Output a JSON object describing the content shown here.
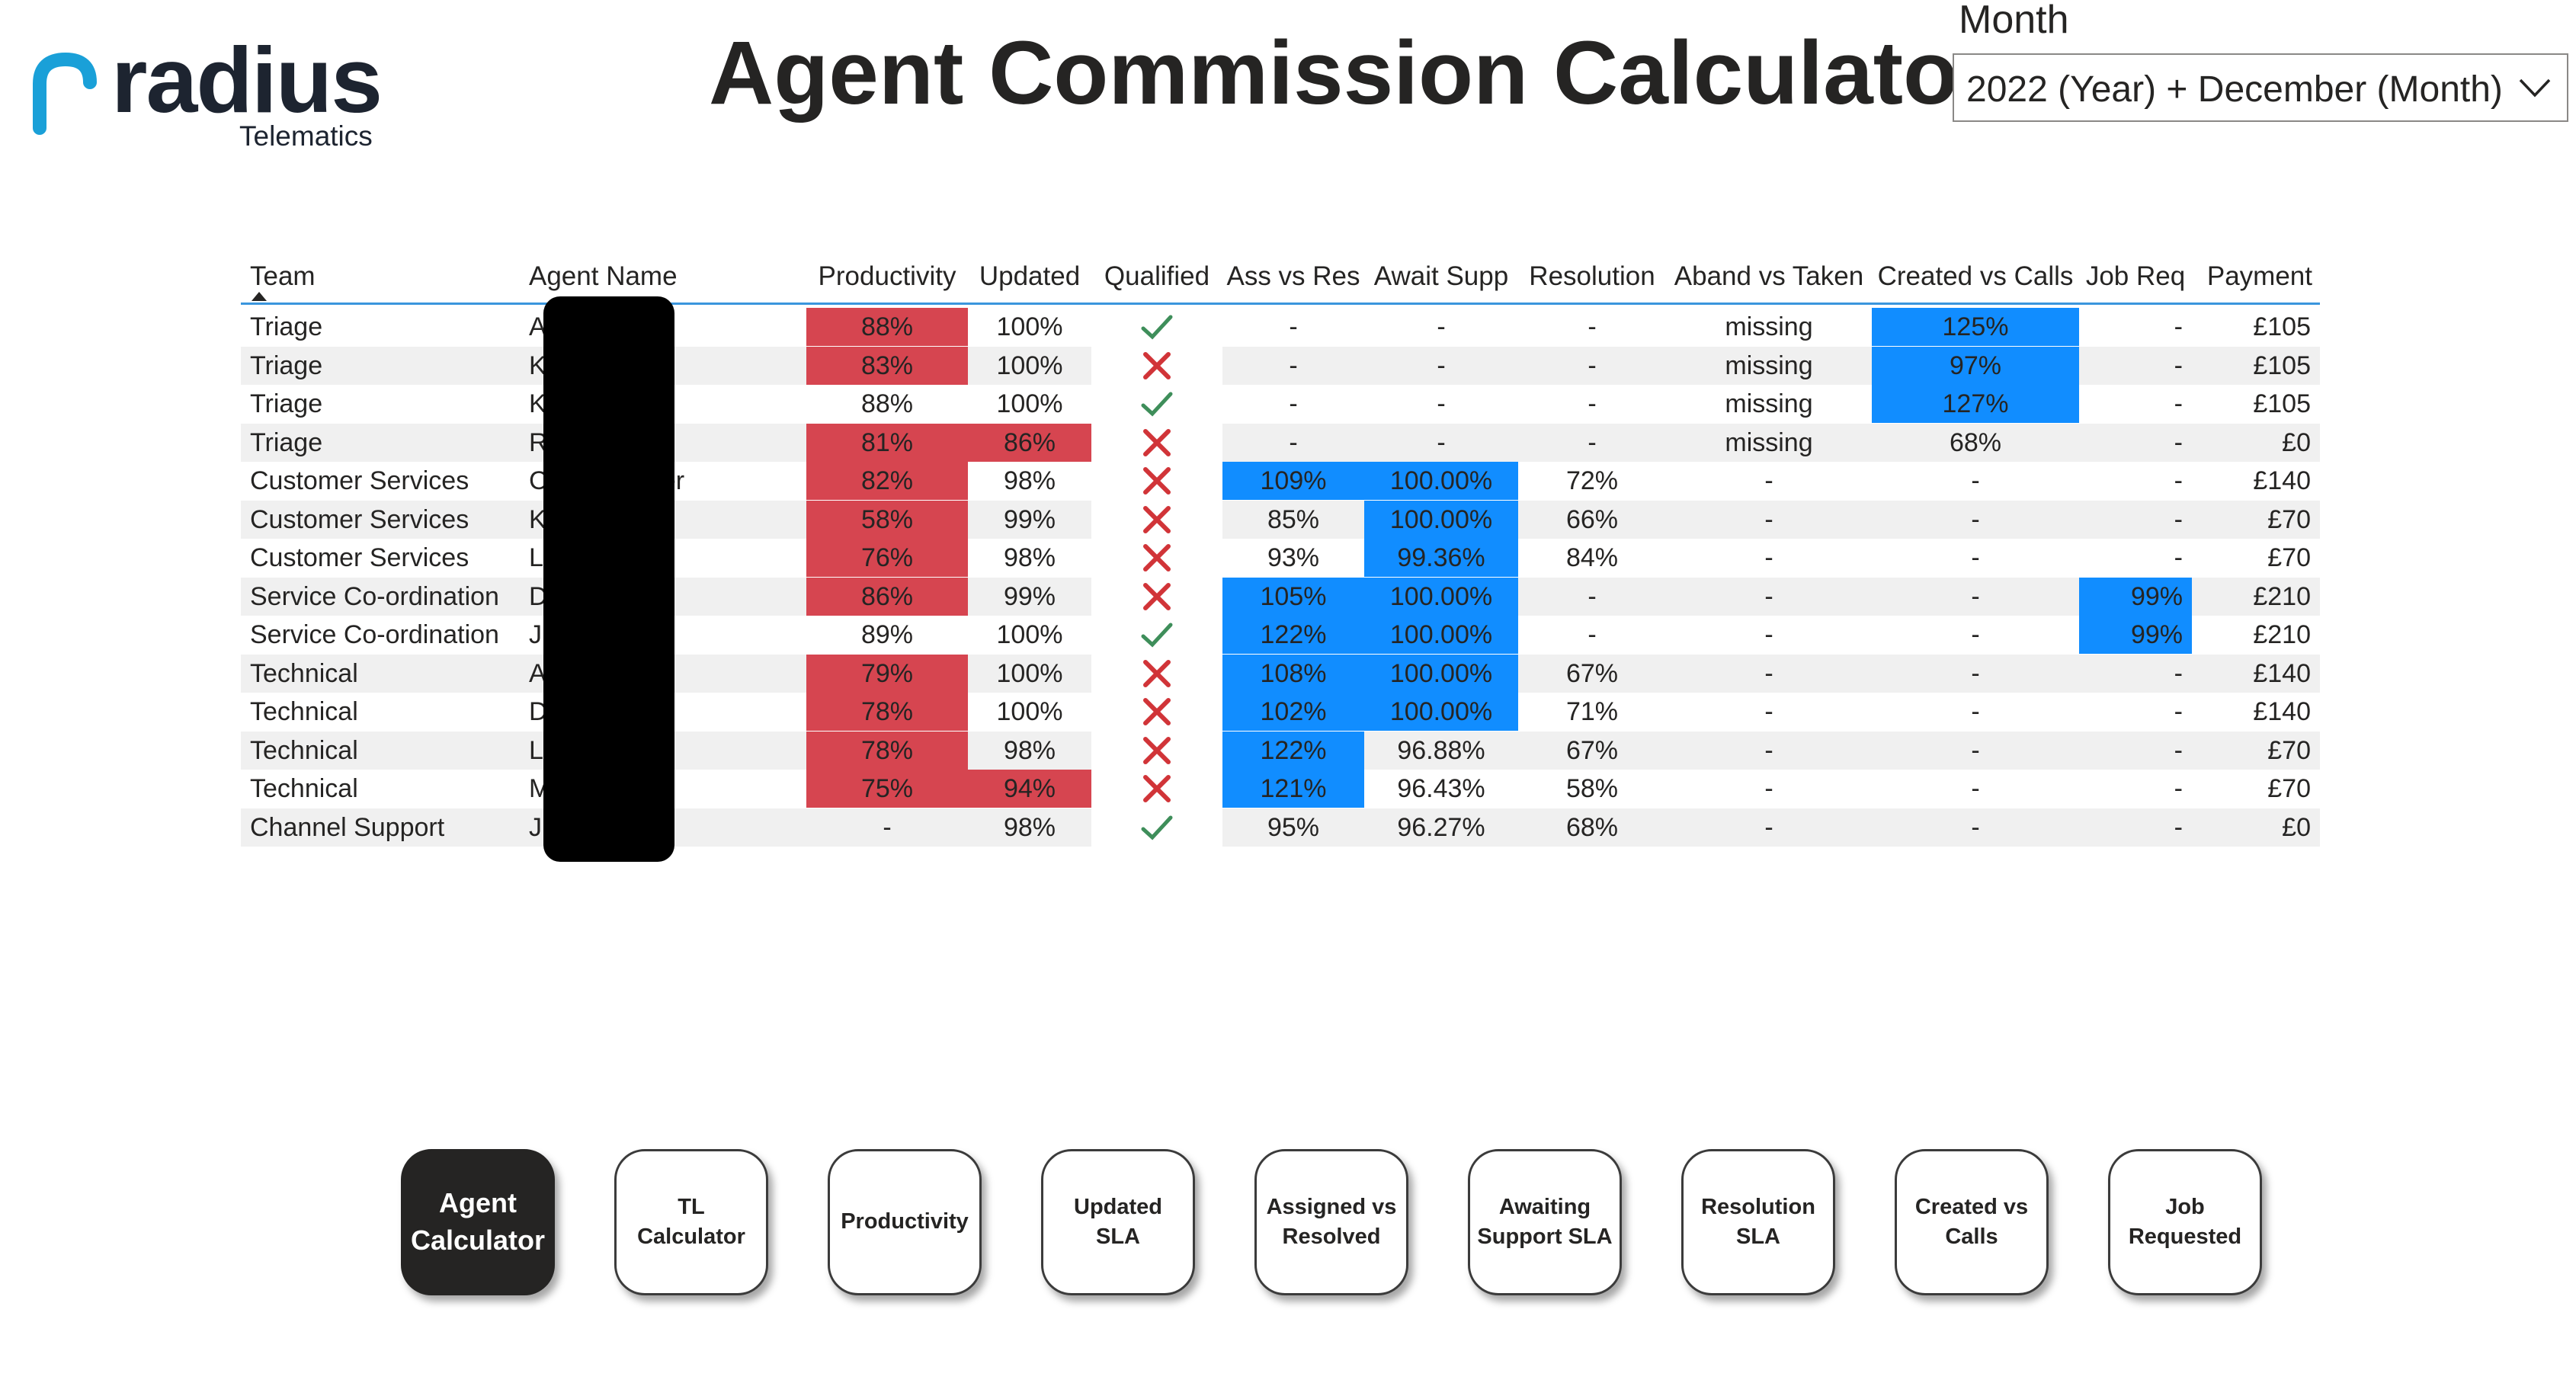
{
  "brand": {
    "name": "radius",
    "subtitle": "Telematics"
  },
  "page": {
    "title": "Agent Commission Calculator"
  },
  "month_filter": {
    "label": "Month",
    "value": "2022 (Year) + December (Month)"
  },
  "table": {
    "headers": {
      "team": "Team",
      "agent": "Agent Name",
      "productivity": "Productivity",
      "updated": "Updated",
      "qualified": "Qualified",
      "ass_vs_res": "Ass vs Res",
      "await_supp": "Await Supp",
      "resolution": "Resolution",
      "aband_vs_taken": "Aband vs Taken",
      "created_vs_calls": "Created vs Calls",
      "job_req": "Job Req",
      "payment": "Payment"
    },
    "sorted_by": "Team",
    "rows": [
      {
        "team": "Triage",
        "agent": "A              han",
        "productivity": "88%",
        "updated": "100%",
        "qualified": true,
        "ass_vs_res": "-",
        "await_supp": "-",
        "resolution": "-",
        "aband_vs_taken": "missing",
        "created_vs_calls": "125%",
        "job_req": "-",
        "payment": "£105"
      },
      {
        "team": "Triage",
        "agent": "K              er",
        "productivity": "83%",
        "updated": "100%",
        "qualified": false,
        "ass_vs_res": "-",
        "await_supp": "-",
        "resolution": "-",
        "aband_vs_taken": "missing",
        "created_vs_calls": "97%",
        "job_req": "-",
        "payment": "£105"
      },
      {
        "team": "Triage",
        "agent": "K              z",
        "productivity": "88%",
        "updated": "100%",
        "qualified": true,
        "ass_vs_res": "-",
        "await_supp": "-",
        "resolution": "-",
        "aband_vs_taken": "missing",
        "created_vs_calls": "127%",
        "job_req": "-",
        "payment": "£105"
      },
      {
        "team": "Triage",
        "agent": "R",
        "productivity": "81%",
        "updated": "86%",
        "qualified": false,
        "ass_vs_res": "-",
        "await_supp": "-",
        "resolution": "-",
        "aband_vs_taken": "missing",
        "created_vs_calls": "68%",
        "job_req": "-",
        "payment": "£0"
      },
      {
        "team": "Customer Services",
        "agent": "C              ereweather",
        "productivity": "82%",
        "updated": "98%",
        "qualified": false,
        "ass_vs_res": "109%",
        "await_supp": "100.00%",
        "resolution": "72%",
        "aband_vs_taken": "-",
        "created_vs_calls": "-",
        "job_req": "-",
        "payment": "£140"
      },
      {
        "team": "Customer Services",
        "agent": "K              ck",
        "productivity": "58%",
        "updated": "99%",
        "qualified": false,
        "ass_vs_res": "85%",
        "await_supp": "100.00%",
        "resolution": "66%",
        "aband_vs_taken": "-",
        "created_vs_calls": "-",
        "job_req": "-",
        "payment": "£70"
      },
      {
        "team": "Customer Services",
        "agent": "L              nes",
        "productivity": "76%",
        "updated": "98%",
        "qualified": false,
        "ass_vs_res": "93%",
        "await_supp": "99.36%",
        "resolution": "84%",
        "aband_vs_taken": "-",
        "created_vs_calls": "-",
        "job_req": "-",
        "payment": "£70"
      },
      {
        "team": "Service Co-ordination",
        "agent": "D              reman",
        "productivity": "86%",
        "updated": "99%",
        "qualified": false,
        "ass_vs_res": "105%",
        "await_supp": "100.00%",
        "resolution": "-",
        "aband_vs_taken": "-",
        "created_vs_calls": "-",
        "job_req": "99%",
        "payment": "£210"
      },
      {
        "team": "Service Co-ordination",
        "agent": "J",
        "productivity": "89%",
        "updated": "100%",
        "qualified": true,
        "ass_vs_res": "122%",
        "await_supp": "100.00%",
        "resolution": "-",
        "aband_vs_taken": "-",
        "created_vs_calls": "-",
        "job_req": "99%",
        "payment": "£210"
      },
      {
        "team": "Technical",
        "agent": "A              es",
        "productivity": "79%",
        "updated": "100%",
        "qualified": false,
        "ass_vs_res": "108%",
        "await_supp": "100.00%",
        "resolution": "67%",
        "aband_vs_taken": "-",
        "created_vs_calls": "-",
        "job_req": "-",
        "payment": "£140"
      },
      {
        "team": "Technical",
        "agent": "D              ey",
        "productivity": "78%",
        "updated": "100%",
        "qualified": false,
        "ass_vs_res": "102%",
        "await_supp": "100.00%",
        "resolution": "71%",
        "aband_vs_taken": "-",
        "created_vs_calls": "-",
        "job_req": "-",
        "payment": "£140"
      },
      {
        "team": "Technical",
        "agent": "L              mbiri",
        "productivity": "78%",
        "updated": "98%",
        "qualified": false,
        "ass_vs_res": "122%",
        "await_supp": "96.88%",
        "resolution": "67%",
        "aband_vs_taken": "-",
        "created_vs_calls": "-",
        "job_req": "-",
        "payment": "£70"
      },
      {
        "team": "Technical",
        "agent": "M",
        "productivity": "75%",
        "updated": "94%",
        "qualified": false,
        "ass_vs_res": "121%",
        "await_supp": "96.43%",
        "resolution": "58%",
        "aband_vs_taken": "-",
        "created_vs_calls": "-",
        "job_req": "-",
        "payment": "£70"
      },
      {
        "team": "Channel Support",
        "agent": "J",
        "productivity": "-",
        "updated": "98%",
        "qualified": true,
        "ass_vs_res": "95%",
        "await_supp": "96.27%",
        "resolution": "68%",
        "aband_vs_taken": "-",
        "created_vs_calls": "-",
        "job_req": "-",
        "payment": "£0"
      }
    ],
    "highlights": {
      "productivity": [
        "red",
        "red",
        "",
        "red",
        "red",
        "red",
        "red",
        "red",
        "",
        "red",
        "red",
        "red",
        "red",
        ""
      ],
      "updated": [
        "",
        "",
        "",
        "red",
        "",
        "",
        "",
        "",
        "",
        "",
        "",
        "",
        "red",
        ""
      ],
      "ass_vs_res": [
        "",
        "",
        "",
        "",
        "blue",
        "",
        "",
        "blue",
        "blue",
        "blue",
        "blue",
        "blue",
        "blue",
        ""
      ],
      "await_supp": [
        "",
        "",
        "",
        "",
        "blue",
        "blue",
        "blue",
        "blue",
        "blue",
        "blue",
        "blue",
        "",
        "",
        ""
      ],
      "created_vs_calls": [
        "blue",
        "blue",
        "blue",
        "",
        "",
        "",
        "",
        "",
        "",
        "",
        "",
        "",
        "",
        ""
      ],
      "job_req": [
        "",
        "",
        "",
        "",
        "",
        "",
        "",
        "blue",
        "blue",
        "",
        "",
        "",
        "",
        ""
      ]
    }
  },
  "colors": {
    "red": "#d64550",
    "blue": "#118dff",
    "green_check": "#3e8e5a",
    "red_cross": "#d13438",
    "header_line": "#3a96dd",
    "brand_accent": "#1aa0d8"
  },
  "icons": {
    "qualified_true": "check-icon",
    "qualified_false": "cross-icon",
    "slicer": "chevron-down-icon"
  },
  "nav": {
    "buttons": [
      {
        "label": "Agent\nCalculator",
        "active": true
      },
      {
        "label": "TL Calculator",
        "active": false
      },
      {
        "label": "Productivity",
        "active": false
      },
      {
        "label": "Updated SLA",
        "active": false
      },
      {
        "label": "Assigned vs\nResolved",
        "active": false
      },
      {
        "label": "Awaiting\nSupport SLA",
        "active": false
      },
      {
        "label": "Resolution\nSLA",
        "active": false
      },
      {
        "label": "Created vs\nCalls",
        "active": false
      },
      {
        "label": "Job\nRequested",
        "active": false
      }
    ]
  }
}
